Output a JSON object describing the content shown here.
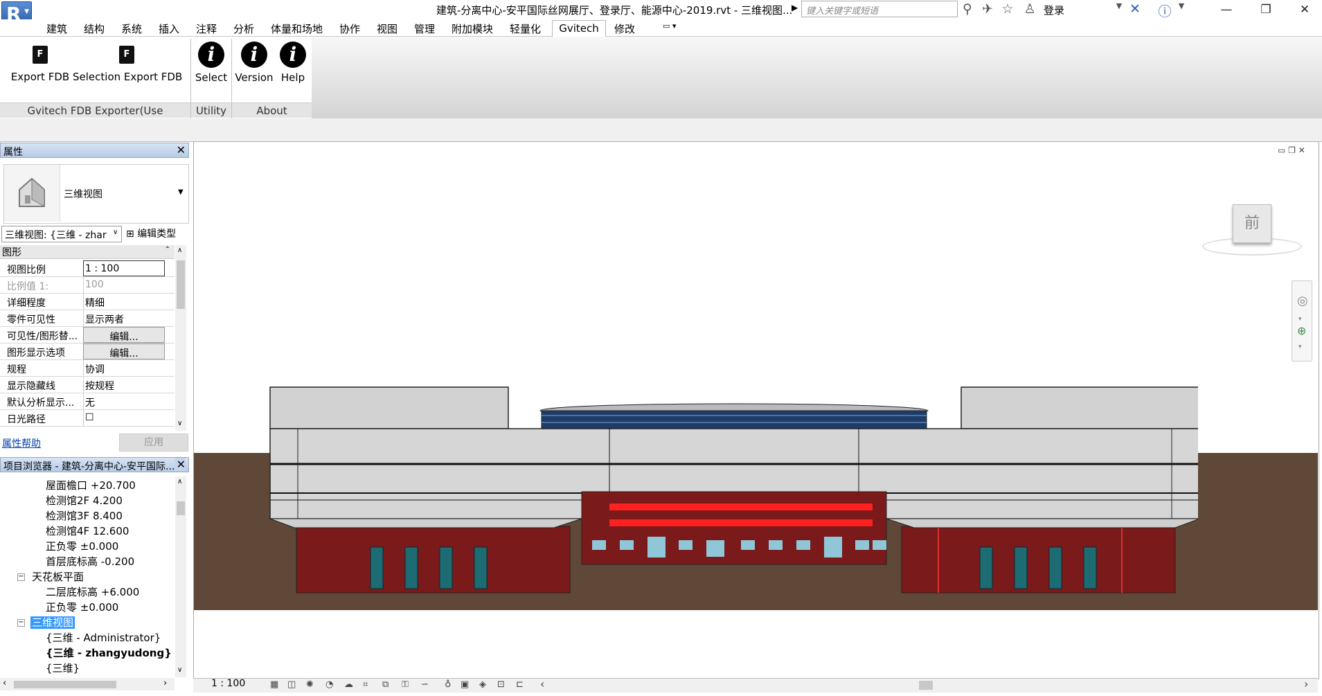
{
  "title_bar": {
    "app_logo": "R",
    "document_title": "建筑-分离中心-安平国际丝网展厅、登录厅、能源中心-2019.rvt - 三维视图...",
    "search_placeholder": "键入关键字或短语",
    "login_label": "登录",
    "icons": [
      "binoculars-icon",
      "satellite-icon",
      "star-icon",
      "user-icon",
      "exchange-icon",
      "help-icon"
    ]
  },
  "menu": {
    "items": [
      "建筑",
      "结构",
      "系统",
      "插入",
      "注释",
      "分析",
      "体量和场地",
      "协作",
      "视图",
      "管理",
      "附加模块",
      "轻量化",
      "Gvitech",
      "修改"
    ],
    "active": "Gvitech"
  },
  "ribbon": {
    "buttons": [
      {
        "label": "Export FDB",
        "icon": "F"
      },
      {
        "label": "Selection Export FDB",
        "icon": "F"
      },
      {
        "label": "Select",
        "icon": "i"
      },
      {
        "label": "Version",
        "icon": "i"
      },
      {
        "label": "Help",
        "icon": "i"
      }
    ],
    "groups": [
      "Gvitech FDB Exporter(Use Category)",
      "Utility",
      "About"
    ]
  },
  "properties": {
    "header": "属性",
    "type_name": "三维视图",
    "view_select": "三维视图: {三维 - zhar",
    "edit_type": "编辑类型",
    "section": "图形",
    "rows": [
      {
        "name": "视图比例",
        "value": "1 : 100"
      },
      {
        "name": "比例值 1:",
        "value": "100"
      },
      {
        "name": "详细程度",
        "value": "精细"
      },
      {
        "name": "零件可见性",
        "value": "显示两者"
      },
      {
        "name": "可见性/图形替...",
        "value": "编辑..."
      },
      {
        "name": "图形显示选项",
        "value": "编辑..."
      },
      {
        "name": "规程",
        "value": "协调"
      },
      {
        "name": "显示隐藏线",
        "value": "按规程"
      },
      {
        "name": "默认分析显示...",
        "value": "无"
      },
      {
        "name": "日光路径",
        "value": "☐"
      }
    ],
    "help_link": "属性帮助",
    "apply_button": "应用"
  },
  "project_browser": {
    "header": "项目浏览器 - 建筑-分离中心-安平国际...",
    "items": [
      "屋面檐口 +20.700",
      "检测馆2F 4.200",
      "检测馆3F 8.400",
      "检测馆4F 12.600",
      "正负零 ±0.000",
      "首层底标高 -0.200",
      "天花板平面",
      "二层底标高 +6.000",
      "正负零 ±0.000",
      "三维视图",
      "{三维 - Administrator}",
      "{三维 - zhangyudong}",
      "{三维}"
    ]
  },
  "viewport": {
    "viewcube_face": "前",
    "scale": "1 : 100"
  },
  "colors": {
    "selection": "#3399ff",
    "ground": "#604838",
    "facade_red": "#7a1a1a"
  }
}
